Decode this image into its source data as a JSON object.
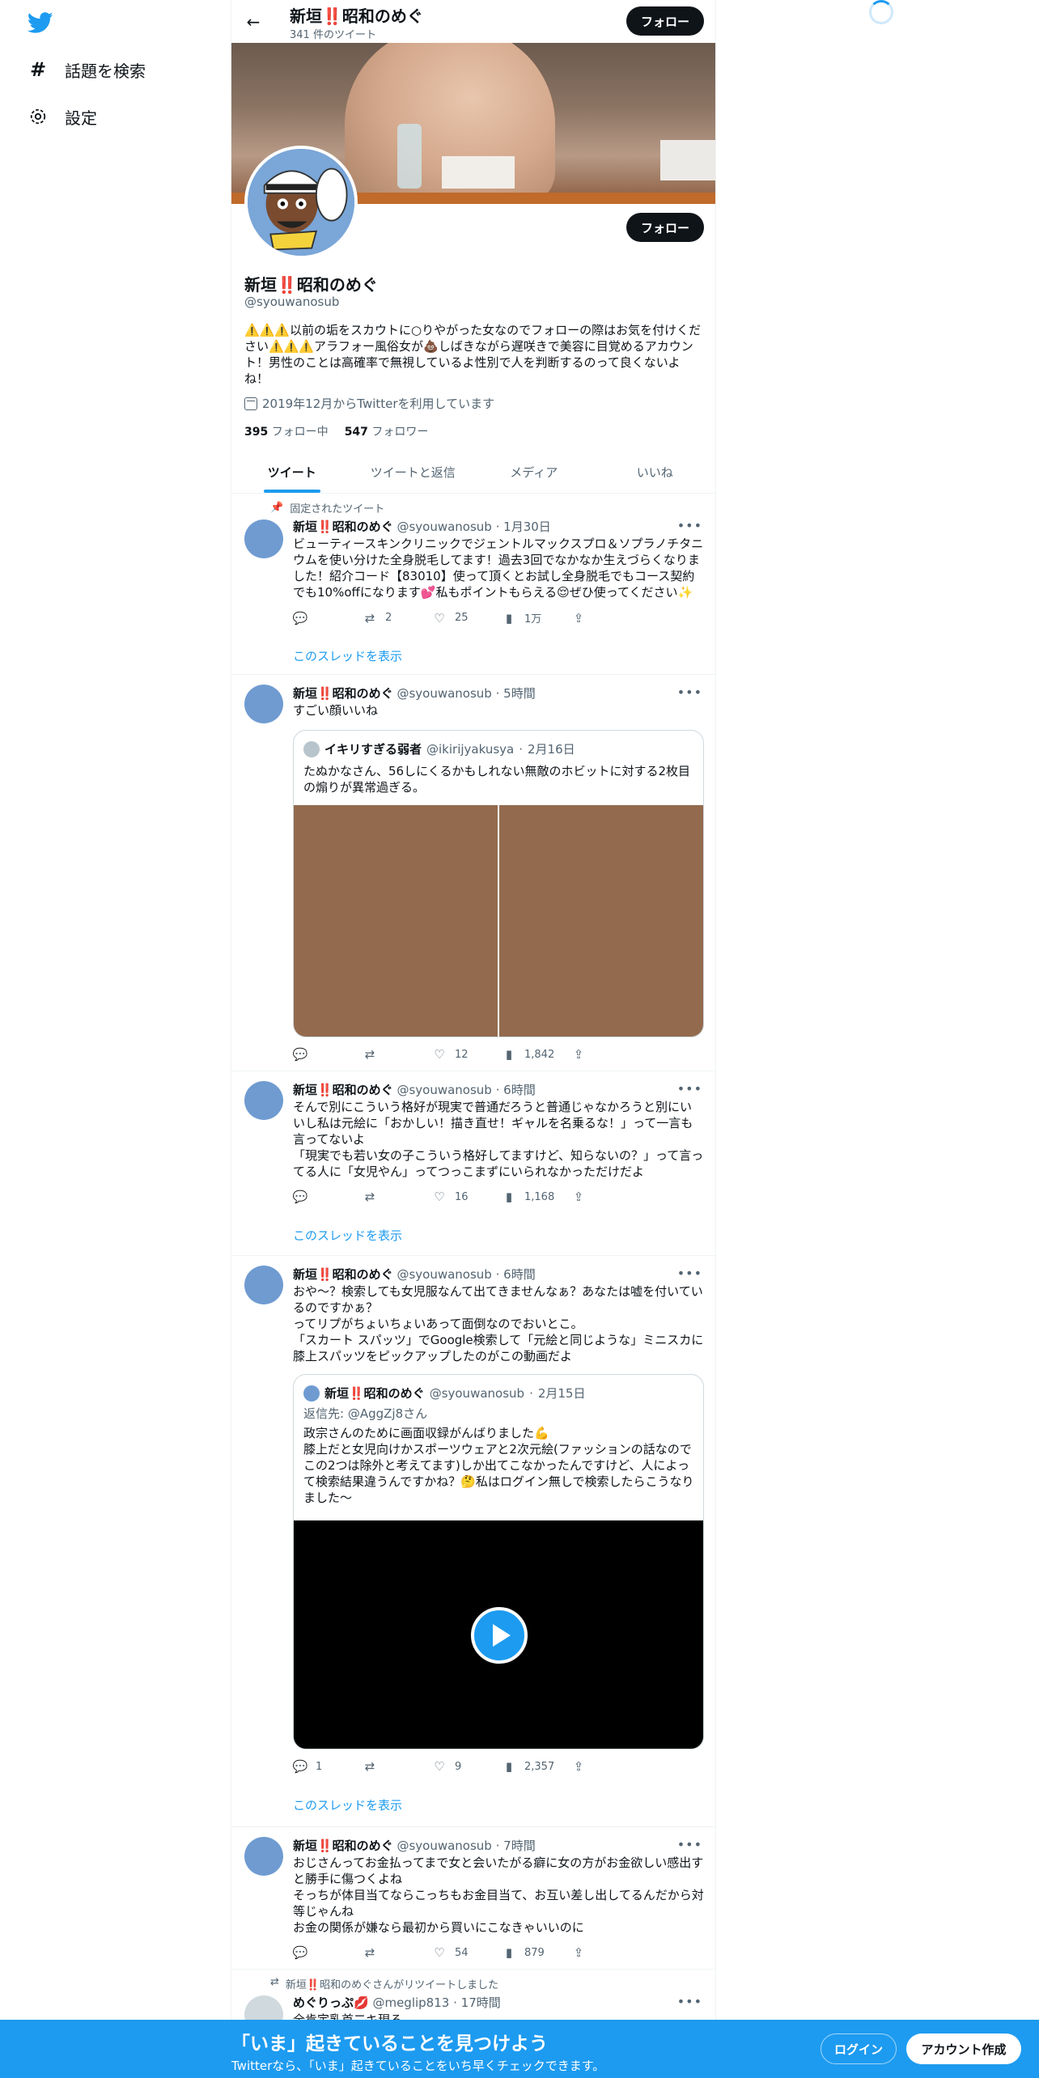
{
  "nav": {
    "explore_label": "話題を検索",
    "settings_label": "設定"
  },
  "header": {
    "name": "新垣‼️昭和のめぐ",
    "tweet_count": "341 件のツイート",
    "follow_label": "フォロー"
  },
  "profile": {
    "name": "新垣‼️昭和のめぐ",
    "handle": "@syouwanosub",
    "bio": "⚠️⚠️⚠️以前の垢をスカウトに○りやがった女なのでフォローの際はお気を付けください⚠️⚠️⚠️アラフォー風俗女が💩しばきながら遅咲きで美容に目覚めるアカウント！男性のことは高確率で無視しているよ性別で人を判断するのって良くないよね！",
    "joined": "2019年12月からTwitterを利用しています",
    "following_count": "395",
    "following_label": "フォロー中",
    "followers_count": "547",
    "followers_label": "フォロワー",
    "follow_label": "フォロー"
  },
  "tabs": [
    {
      "label": "ツイート"
    },
    {
      "label": "ツイートと返信"
    },
    {
      "label": "メディア"
    },
    {
      "label": "いいね"
    }
  ],
  "tweets": [
    {
      "pinned_label": "固定されたツイート",
      "name": "新垣‼️昭和のめぐ",
      "handle": "@syouwanosub",
      "time": "1月30日",
      "text": "ビューティースキンクリニックでジェントルマックスプロ＆ソプラノチタニウムを使い分けた全身脱毛してます！過去3回でなかなか生えづらくなりました！紹介コード【83010】使って頂くとお試し全身脱毛でもコース契約でも10%offになります💕私もポイントもらえる😌ぜひ使ってください✨",
      "reply": "",
      "retweet": "2",
      "like": "25",
      "views": "1万",
      "show_thread": "このスレッドを表示"
    },
    {
      "name": "新垣‼️昭和のめぐ",
      "handle": "@syouwanosub",
      "time": "5時間",
      "text": "すごい顔いいね",
      "quote": {
        "name": "イキリすぎる弱者",
        "handle": "@ikirijyakusya",
        "time": "2月16日",
        "text": "たぬかなさん、56しにくるかもしれない無敵のホビットに対する2枚目の煽りが異常過ぎる。"
      },
      "reply": "",
      "retweet": "",
      "like": "12",
      "views": "1,842"
    },
    {
      "name": "新垣‼️昭和のめぐ",
      "handle": "@syouwanosub",
      "time": "6時間",
      "text": "そんで別にこういう格好が現実で普通だろうと普通じゃなかろうと別にいいし私は元絵に「おかしい！描き直せ！ギャルを名乗るな！」って一言も言ってないよ\n「現実でも若い女の子こういう格好してますけど、知らないの？」って言ってる人に「女児やん」ってつっこまずにいられなかっただけだよ",
      "reply": "",
      "retweet": "",
      "like": "16",
      "views": "1,168",
      "show_thread": "このスレッドを表示"
    },
    {
      "name": "新垣‼️昭和のめぐ",
      "handle": "@syouwanosub",
      "time": "6時間",
      "text": "おや〜？検索しても女児服なんて出てきませんなぁ？あなたは嘘を付いているのですかぁ？\nってリプがちょいちょいあって面倒なのでおいとこ。\n「スカート スパッツ」でGoogle検索して「元絵と同じような」ミニスカに膝上スパッツをピックアップしたのがこの動画だよ",
      "quote": {
        "name": "新垣‼️昭和のめぐ",
        "handle": "@syouwanosub",
        "time": "2月15日",
        "reply_to": "返信先: @AggZj8さん",
        "text": "政宗さんのために画面収録がんばりました💪\n膝上だと女児向けかスポーツウェアと2次元絵(ファッションの話なのでこの2つは除外と考えてます)しか出てこなかったんですけど、人によって検索結果違うんですかね？🤔私はログイン無しで検索したらこうなりました〜"
      },
      "reply": "1",
      "retweet": "",
      "like": "9",
      "views": "2,357",
      "show_thread": "このスレッドを表示"
    },
    {
      "name": "新垣‼️昭和のめぐ",
      "handle": "@syouwanosub",
      "time": "7時間",
      "text": "おじさんってお金払ってまで女と会いたがる癖に女の方がお金欲しい感出すと勝手に傷つくよね\nそっちが体目当てならこっちもお金目当て、お互い差し出してるんだから対等じゃんね\nお金の関係が嫌なら最初から買いにこなきゃいいのに",
      "reply": "",
      "retweet": "",
      "like": "54",
      "views": "879"
    },
    {
      "retweet_label": "新垣‼️昭和のめぐさんがリツイートしました",
      "name": "めぐりっぷ💋",
      "handle": "@meglip813",
      "time": "17時間",
      "text": "全肯定乳首二キ現る"
    }
  ],
  "bottom_bar": {
    "title": "「いま」起きていることを見つけよう",
    "subtitle": "Twitterなら、「いま」起きていることをいち早くチェックできます。",
    "login_label": "ログイン",
    "signup_label": "アカウント作成"
  },
  "colors": {
    "accent": "#1d9bf0",
    "text": "#0f1419",
    "muted": "#536471"
  }
}
